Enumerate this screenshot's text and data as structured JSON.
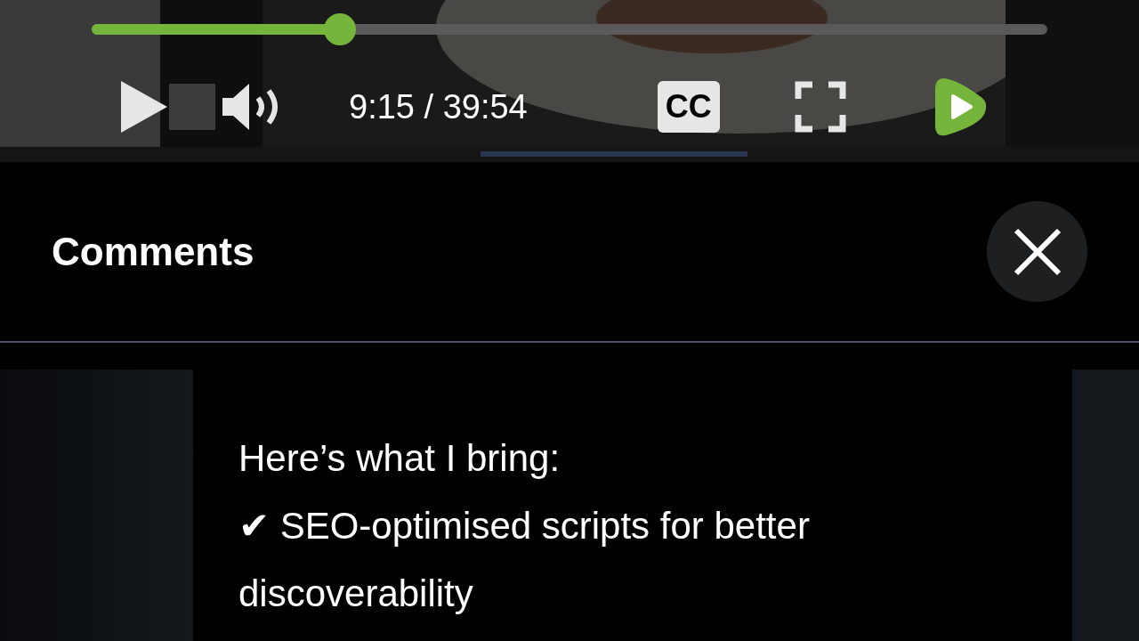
{
  "player": {
    "progress": {
      "level": 0.26
    },
    "time": "9:15 / 39:54",
    "captions_label": "CC"
  },
  "comments": {
    "title": "Comments",
    "lines": [
      "Here’s what I bring:",
      "✔ SEO-optimised scripts for better discoverability"
    ]
  }
}
